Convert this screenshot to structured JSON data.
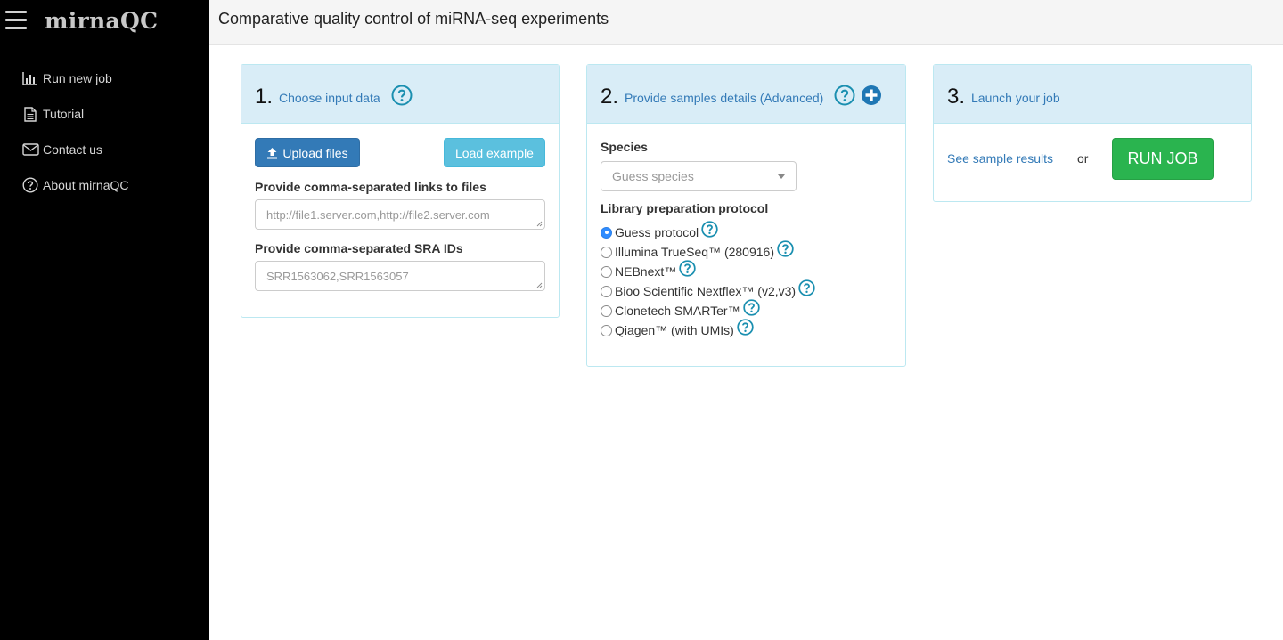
{
  "app": {
    "brand": "mirnaQC"
  },
  "sidebar": {
    "items": [
      {
        "label": "Run new job",
        "icon": "bar-chart-icon"
      },
      {
        "label": "Tutorial",
        "icon": "file-icon"
      },
      {
        "label": "Contact us",
        "icon": "envelope-icon"
      },
      {
        "label": "About mirnaQC",
        "icon": "question-circle-icon"
      }
    ]
  },
  "header": {
    "title": "Comparative quality control of miRNA-seq experiments"
  },
  "panel1": {
    "number": "1.",
    "title": "Choose input data",
    "upload_label": "Upload files",
    "load_example_label": "Load example",
    "links_label": "Provide comma-separated links to files",
    "links_placeholder": "http://file1.server.com,http://file2.server.com",
    "sra_label": "Provide comma-separated SRA IDs",
    "sra_placeholder": "SRR1563062,SRR1563057"
  },
  "panel2": {
    "number": "2.",
    "title": "Provide samples details (Advanced)",
    "species_label": "Species",
    "species_selected": "Guess species",
    "protocol_label": "Library preparation protocol",
    "protocols": [
      {
        "label": "Guess protocol",
        "selected": true
      },
      {
        "label": "Illumina TrueSeq™ (280916)",
        "selected": false
      },
      {
        "label": "NEBnext™",
        "selected": false
      },
      {
        "label": "Bioo Scientific Nextflex™ (v2,v3)",
        "selected": false
      },
      {
        "label": "Clonetech SMARTer™",
        "selected": false
      },
      {
        "label": "Qiagen™ (with UMIs)",
        "selected": false
      }
    ]
  },
  "panel3": {
    "number": "3.",
    "title": "Launch your job",
    "sample_results_label": "See sample results",
    "or_label": "or",
    "run_job_label": "RUN JOB"
  },
  "colors": {
    "sidebar_bg": "#000000",
    "panel_head_bg": "#d9edf7",
    "link": "#337ab7",
    "primary": "#337ab7",
    "info": "#5bc0de",
    "success": "#2ab44f",
    "help_icon": "#1a8fb0"
  }
}
